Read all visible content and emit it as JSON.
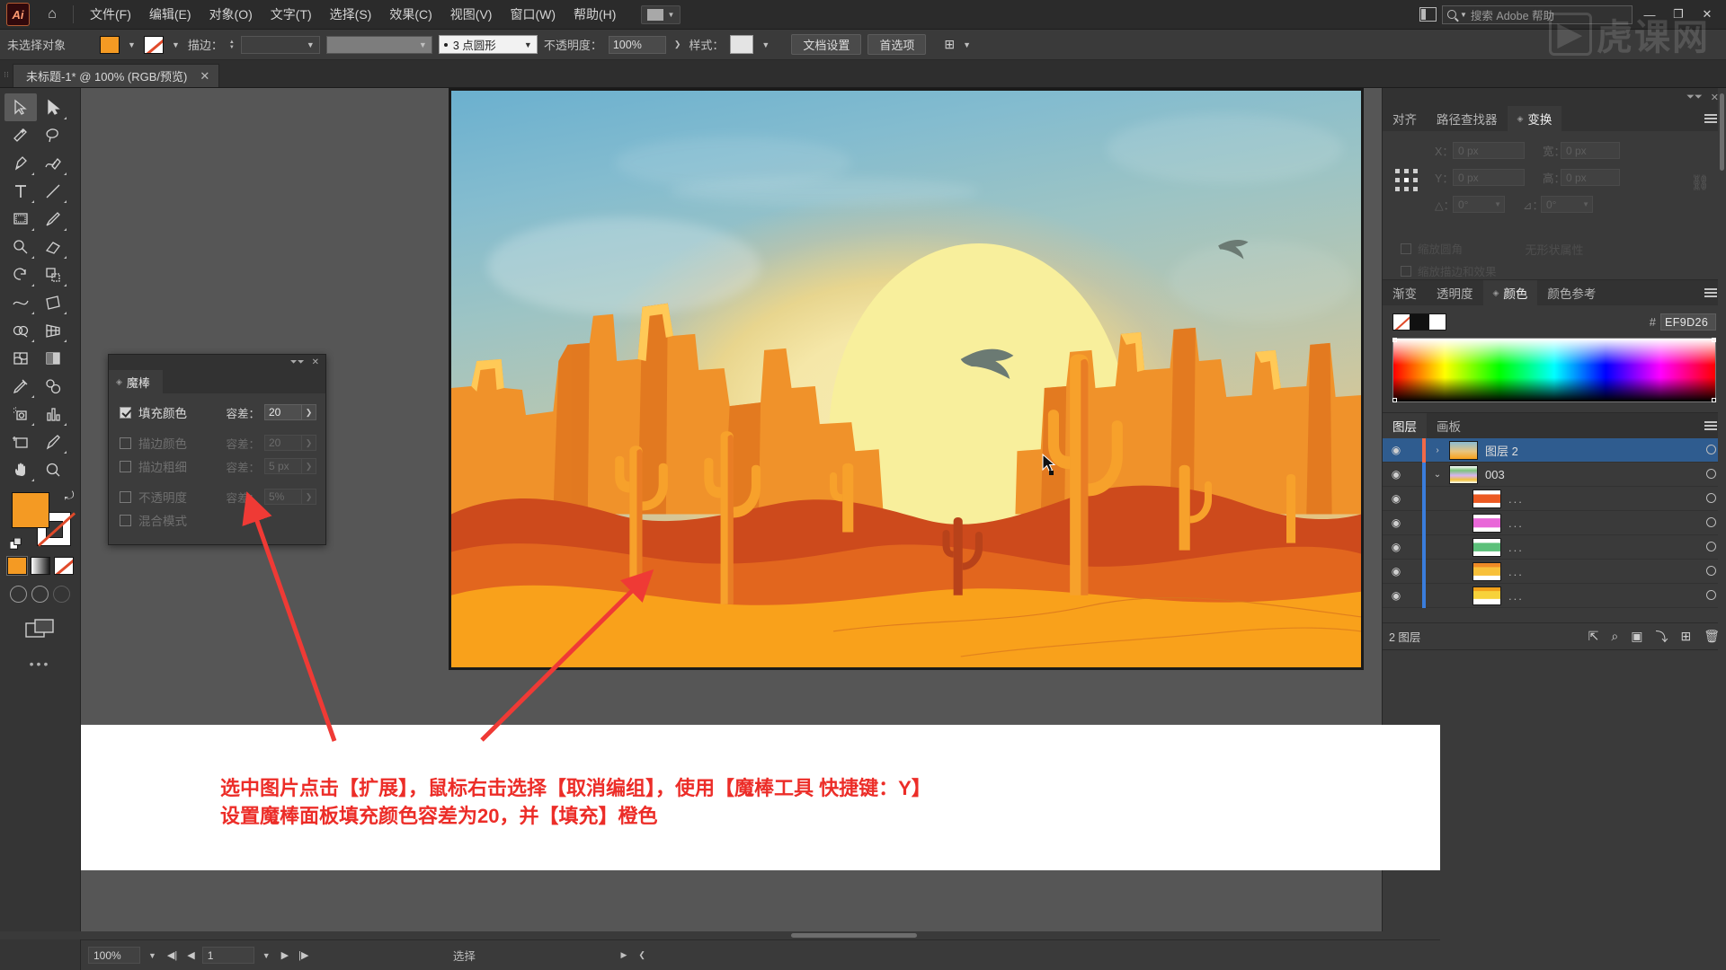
{
  "app": {
    "logo": "Ai",
    "watermark": "虎课网"
  },
  "menubar": {
    "home_icon": "home-icon",
    "items": [
      "文件(F)",
      "编辑(E)",
      "对象(O)",
      "文字(T)",
      "选择(S)",
      "效果(C)",
      "视图(V)",
      "窗口(W)",
      "帮助(H)"
    ],
    "arrange_docs_label": "",
    "search_placeholder": "搜索 Adobe 帮助",
    "window_buttons": [
      "—",
      "❐",
      "✕"
    ]
  },
  "controlbar": {
    "selection_status": "未选择对象",
    "fill_color": "#f49a23",
    "stroke_label": "描边：",
    "stroke_weight": "",
    "stroke_profile": "",
    "brush_def": "3 点圆形",
    "opacity_label": "不透明度：",
    "opacity_value": "100%",
    "style_label": "样式：",
    "doc_setup_button": "文档设置",
    "preferences_button": "首选项"
  },
  "tabbar": {
    "document_tab": "未标题-1* @ 100% (RGB/预览)",
    "close_glyph": "✕"
  },
  "toolbar": {
    "tools": [
      {
        "name": "selection-tool",
        "active": true
      },
      {
        "name": "direct-selection-tool",
        "active": false
      },
      {
        "name": "magic-wand-tool",
        "active": false
      },
      {
        "name": "lasso-tool",
        "active": false
      },
      {
        "name": "pen-tool",
        "active": false
      },
      {
        "name": "curvature-tool",
        "active": false
      },
      {
        "name": "type-tool",
        "active": false
      },
      {
        "name": "line-segment-tool",
        "active": false
      },
      {
        "name": "rectangle-tool",
        "active": false
      },
      {
        "name": "paintbrush-tool",
        "active": false
      },
      {
        "name": "shaper-tool",
        "active": false
      },
      {
        "name": "eraser-tool",
        "active": false
      },
      {
        "name": "rotate-tool",
        "active": false
      },
      {
        "name": "scale-tool",
        "active": false
      },
      {
        "name": "width-tool",
        "active": false
      },
      {
        "name": "free-transform-tool",
        "active": false
      },
      {
        "name": "shape-builder-tool",
        "active": false
      },
      {
        "name": "perspective-grid-tool",
        "active": false
      },
      {
        "name": "mesh-tool",
        "active": false
      },
      {
        "name": "gradient-tool",
        "active": false
      },
      {
        "name": "eyedropper-tool",
        "active": false
      },
      {
        "name": "blend-tool",
        "active": false
      },
      {
        "name": "symbol-sprayer-tool",
        "active": false
      },
      {
        "name": "column-graph-tool",
        "active": false
      },
      {
        "name": "artboard-tool",
        "active": false
      },
      {
        "name": "slice-tool",
        "active": false
      },
      {
        "name": "hand-tool",
        "active": false
      },
      {
        "name": "zoom-tool",
        "active": false
      }
    ],
    "fill_swatch": "#f49a23",
    "stroke_swatch": "none",
    "color_modes": [
      "color",
      "gradient",
      "none"
    ],
    "more_tools": "•••"
  },
  "wand_panel": {
    "title": "魔棒",
    "rows": [
      {
        "label": "填充颜色",
        "checked": true,
        "tol_label": "容差：",
        "tol_value": "20",
        "enabled": true
      },
      {
        "label": "描边颜色",
        "checked": false,
        "tol_label": "容差：",
        "tol_value": "20",
        "enabled": false
      },
      {
        "label": "描边粗细",
        "checked": false,
        "tol_label": "容差：",
        "tol_value": "5 px",
        "enabled": false
      },
      {
        "label": "不透明度",
        "checked": false,
        "tol_label": "容差：",
        "tol_value": "5%",
        "enabled": false
      },
      {
        "label": "混合模式",
        "checked": false,
        "tol_label": "",
        "tol_value": "",
        "enabled": false
      }
    ],
    "close_glyph": "✕",
    "collapse_glyph": "⏷⏷"
  },
  "transform_panel": {
    "tabs": [
      {
        "label": "对齐",
        "active": false
      },
      {
        "label": "路径查找器",
        "active": false
      },
      {
        "label": "变换",
        "active": true
      }
    ],
    "fields": {
      "x_label": "X：",
      "x_value": "0 px",
      "y_label": "Y：",
      "y_value": "0 px",
      "w_label": "宽：",
      "w_value": "0 px",
      "h_label": "高：",
      "h_value": "0 px",
      "angle_label": "△：",
      "angle_value": "0°",
      "shear_label": "⊿：",
      "shear_value": "0°"
    },
    "checkbox_scale_corners": "缩放圆角",
    "checkbox_scale_strokes": "缩放描边和效果",
    "empty_message": "无形状属性"
  },
  "color_panel": {
    "tabs": [
      {
        "label": "渐变",
        "active": false
      },
      {
        "label": "透明度",
        "active": false
      },
      {
        "label": "颜色",
        "active": true
      },
      {
        "label": "颜色参考",
        "active": false
      }
    ],
    "hex_symbol": "#",
    "hex_value": "EF9D26",
    "swatches": [
      "none",
      "#111111",
      "#ffffff"
    ]
  },
  "layers_panel": {
    "tabs": [
      {
        "label": "图层",
        "active": true
      },
      {
        "label": "画板",
        "active": false
      }
    ],
    "rows": [
      {
        "name": "图层 2",
        "selected": true,
        "color": "#f06a48",
        "thumb": "sunset",
        "disclosure": "›",
        "indent": 0
      },
      {
        "name": "003",
        "selected": false,
        "color": "#3a7ddc",
        "thumb": "multicolor",
        "disclosure": "⌄",
        "indent": 1
      },
      {
        "name": "...",
        "selected": false,
        "color": "#3a7ddc",
        "thumb": "orange",
        "disclosure": "",
        "indent": 2
      },
      {
        "name": "...",
        "selected": false,
        "color": "#3a7ddc",
        "thumb": "magenta",
        "disclosure": "",
        "indent": 2
      },
      {
        "name": "...",
        "selected": false,
        "color": "#3a7ddc",
        "thumb": "green",
        "disclosure": "",
        "indent": 2
      },
      {
        "name": "...",
        "selected": false,
        "color": "#3a7ddc",
        "thumb": "amber",
        "disclosure": "",
        "indent": 2
      },
      {
        "name": "...",
        "selected": false,
        "color": "#3a7ddc",
        "thumb": "yellow",
        "disclosure": "",
        "indent": 2
      }
    ],
    "footer_count": "2 图层",
    "footer_icons": [
      "locate-object-icon",
      "make-clipping-mask-icon",
      "create-sublayer-icon",
      "create-new-layer-icon",
      "delete-selection-icon"
    ]
  },
  "annotation": {
    "line1": "选中图片点击【扩展】，鼠标右击选择【取消编组】，使用【魔棒工具 快捷键：Y】",
    "line2": "设置魔棒面板填充颜色容差为20，并【填充】橙色",
    "color": "#ec2d28"
  },
  "statusbar": {
    "zoom_value": "100%",
    "page_value": "1",
    "status_text": "选择",
    "nav_first": "◀|",
    "nav_prev": "◀",
    "nav_next": "▶",
    "nav_last": "|▶"
  },
  "artwork": {
    "title": "desert-sunset-illustration",
    "colors": {
      "sky_top": "#6bb0cf",
      "sky_mid": "#b6c6b2",
      "sky_low": "#e8c47f",
      "sun": "#f8ef9c",
      "mesa_light": "#f7a92c",
      "mesa_mid": "#ef8b26",
      "mesa_dark": "#d8521f",
      "dune_front": "#f9a11b",
      "dune_back": "#c6431a",
      "cactus": "#f7a12b",
      "bird": "#6b7a73"
    }
  }
}
